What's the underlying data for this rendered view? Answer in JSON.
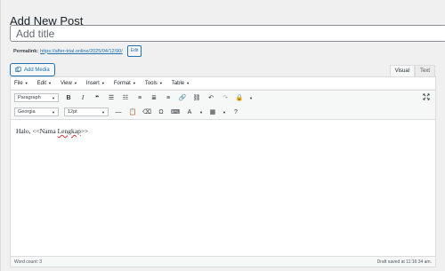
{
  "page": {
    "title": "Add New Post"
  },
  "title_field": {
    "placeholder": "Add title"
  },
  "permalink": {
    "label": "Permalink:",
    "url": "https://after-trial.online/2025/04/12/90/",
    "edit_label": "Edit"
  },
  "media": {
    "add_label": "Add Media"
  },
  "tabs": [
    {
      "label": "Visual",
      "active": true
    },
    {
      "label": "Text",
      "active": false
    }
  ],
  "menubar": [
    {
      "label": "File"
    },
    {
      "label": "Edit"
    },
    {
      "label": "View"
    },
    {
      "label": "Insert"
    },
    {
      "label": "Format"
    },
    {
      "label": "Tools"
    },
    {
      "label": "Table"
    }
  ],
  "toolbar": {
    "paragraph_select": "Paragraph",
    "font_select": "Georgia",
    "size_select": "12pt"
  },
  "content": {
    "prefix": "Halo, <<Nama ",
    "misspelled": "Lengkap",
    "suffix": ">>"
  },
  "status": {
    "word_count": "Word count: 3",
    "draft_saved": "Draft saved at 11:16:34 am."
  },
  "colors": {
    "accent": "#2271b1",
    "background": "#f0f0f1",
    "border": "#dcdcde",
    "spellcheck": "#d63638"
  }
}
